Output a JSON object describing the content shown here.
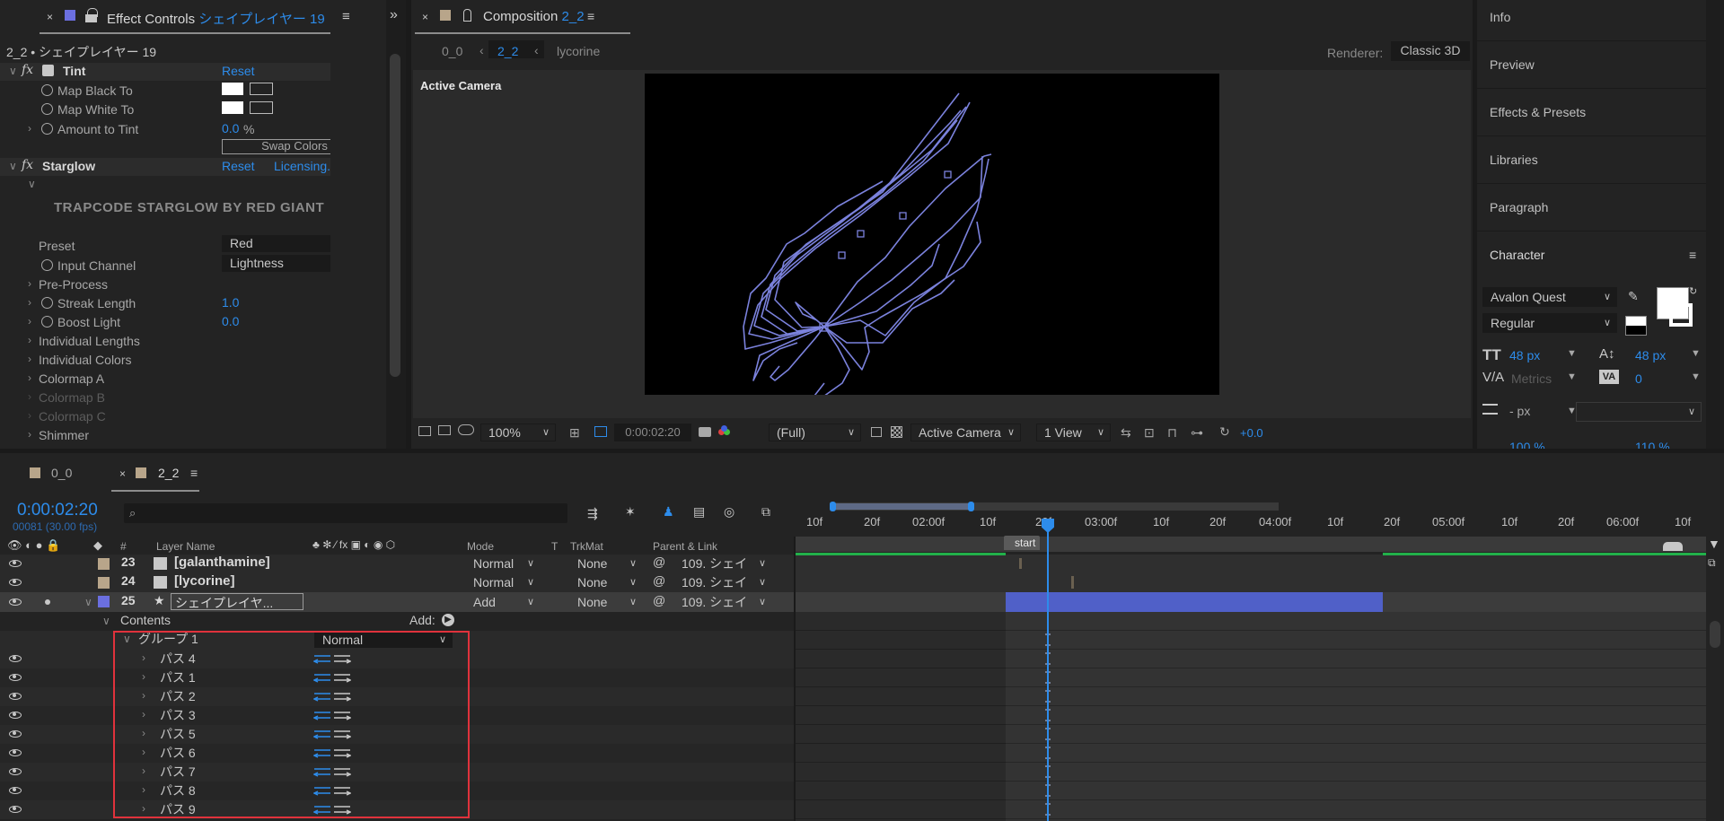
{
  "effect_controls": {
    "tab_prefix": "Effect Controls",
    "tab_layer": "シェイプレイヤー 19",
    "breadcrumb": "2_2 • シェイプレイヤー 19",
    "tint": {
      "name": "Tint",
      "reset": "Reset",
      "map_black": "Map Black To",
      "map_white": "Map White To",
      "amount_label": "Amount to Tint",
      "amount_value": "0.0",
      "amount_unit": "%",
      "swap": "Swap Colors"
    },
    "starglow": {
      "name": "Starglow",
      "reset": "Reset",
      "licensing": "Licensing...",
      "banner": "TRAPCODE STARGLOW BY RED GIANT",
      "preset_label": "Preset",
      "preset_value": "Red",
      "input_channel_label": "Input Channel",
      "input_channel_value": "Lightness",
      "pre_process": "Pre-Process",
      "streak_label": "Streak Length",
      "streak_value": "1.0",
      "boost_label": "Boost Light",
      "boost_value": "0.0",
      "individual_lengths": "Individual Lengths",
      "individual_colors": "Individual Colors",
      "colormap_a": "Colormap A",
      "colormap_b": "Colormap B",
      "colormap_c": "Colormap C",
      "shimmer": "Shimmer"
    }
  },
  "composition": {
    "tab_prefix": "Composition",
    "tab_name": "2_2",
    "nav": [
      "0_0",
      "2_2",
      "lycorine"
    ],
    "renderer_label": "Renderer:",
    "renderer_value": "Classic 3D",
    "active_camera": "Active Camera",
    "toolbar": {
      "zoom": "100%",
      "timecode": "0:00:02:20",
      "resolution": "(Full)",
      "camera": "Active Camera",
      "views": "1 View",
      "exposure": "+0.0"
    }
  },
  "right_panels": {
    "items": [
      "Info",
      "Preview",
      "Effects & Presets",
      "Libraries",
      "Paragraph"
    ],
    "character": {
      "title": "Character",
      "font": "Avalon Quest",
      "style": "Regular",
      "size": "48 px",
      "leading": "48 px",
      "kerning": "Metrics",
      "tracking": "0",
      "stroke_width": "- px",
      "h_scale": "100 %",
      "v_scale": "110 %"
    }
  },
  "timeline": {
    "tabs": [
      "0_0",
      "2_2"
    ],
    "timecode": "0:00:02:20",
    "frame_info": "00081 (30.00 fps)",
    "search_placeholder": "",
    "headers": {
      "num": "#",
      "layer_name": "Layer Name",
      "mode": "Mode",
      "t": "T",
      "trkmat": "TrkMat",
      "parent": "Parent & Link"
    },
    "layers": [
      {
        "num": "23",
        "name": "[galanthamine]",
        "mode": "Normal",
        "trkmat": "None",
        "parent": "109. シェイ"
      },
      {
        "num": "24",
        "name": "[lycorine]",
        "mode": "Normal",
        "trkmat": "None",
        "parent": "109. シェイ"
      },
      {
        "num": "25",
        "name": "シェイプレイヤ...",
        "mode": "Add",
        "trkmat": "None",
        "parent": "109. シェイ"
      }
    ],
    "contents_label": "Contents",
    "add_label": "Add:",
    "group": {
      "name": "グループ 1",
      "mode": "Normal"
    },
    "paths": [
      "パス 4",
      "パス 1",
      "パス 2",
      "パス 3",
      "パス 5",
      "パス 6",
      "パス 7",
      "パス 8",
      "パス 9"
    ],
    "ruler": [
      "10f",
      "20f",
      "02:00f",
      "10f",
      "20f",
      "03:00f",
      "10f",
      "20f",
      "04:00f",
      "10f",
      "20f",
      "05:00f",
      "10f",
      "20f",
      "06:00f",
      "10f"
    ],
    "marker": "start"
  }
}
